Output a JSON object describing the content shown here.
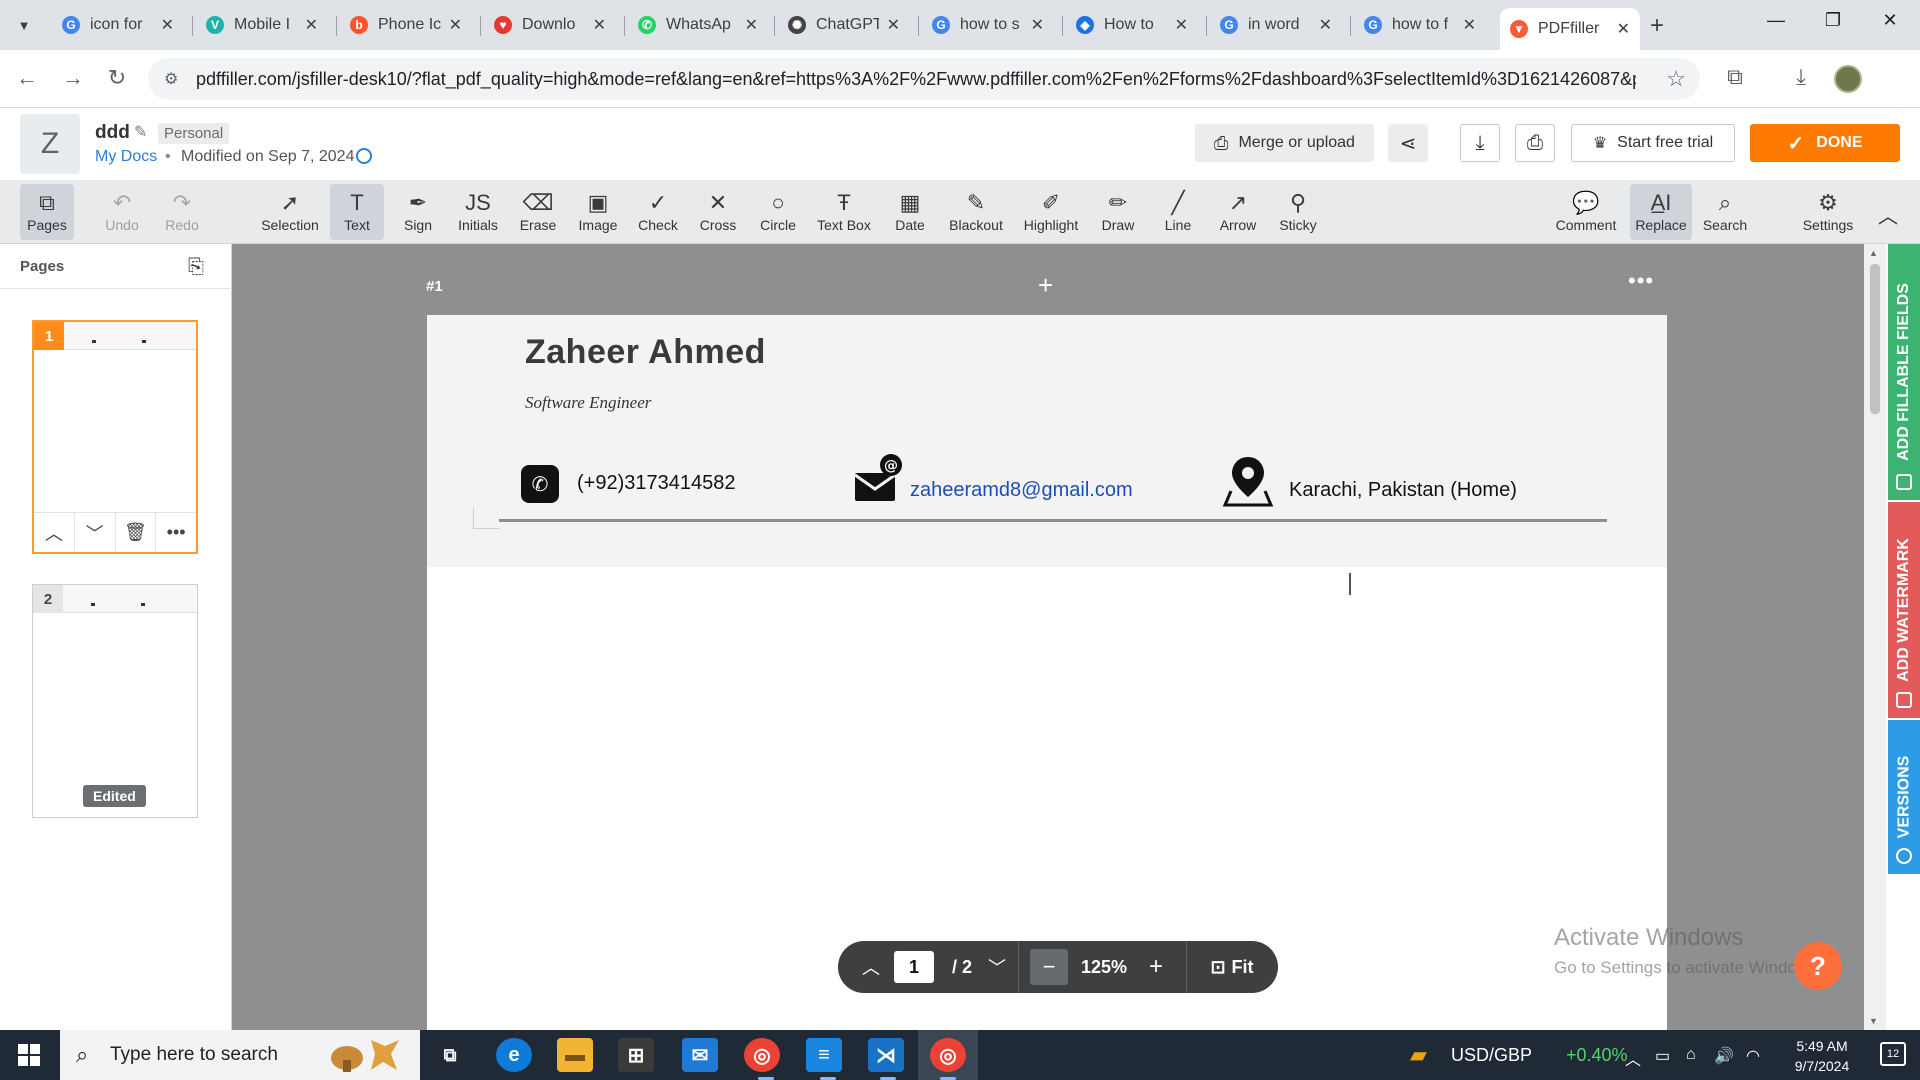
{
  "browser": {
    "tabs": [
      {
        "title": "icon for",
        "favicon": "google-icon",
        "color": "#4285f4"
      },
      {
        "title": "Mobile I",
        "favicon": "vector-icon",
        "color": "#20b2aa"
      },
      {
        "title": "Phone Ic",
        "favicon": "brave-icon",
        "color": "#fb542b"
      },
      {
        "title": "Downlo",
        "favicon": "heart-icon",
        "color": "#e53935"
      },
      {
        "title": "WhatsAp",
        "favicon": "whatsapp-icon",
        "color": "#25d366"
      },
      {
        "title": "ChatGPT",
        "favicon": "chatgpt-icon",
        "color": "#444444"
      },
      {
        "title": "how to s",
        "favicon": "google-icon",
        "color": "#4285f4"
      },
      {
        "title": "How to",
        "favicon": "tab-icon",
        "color": "#1a73e8"
      },
      {
        "title": "in word",
        "favicon": "google-icon",
        "color": "#4285f4"
      },
      {
        "title": "how to f",
        "favicon": "google-icon",
        "color": "#4285f4"
      },
      {
        "title": "PDFfiller",
        "favicon": "pdffiller-icon",
        "color": "#ff5a36",
        "active": true
      }
    ],
    "url": "pdffiller.com/jsfiller-desk10/?flat_pdf_quality=high&mode=ref&lang=en&ref=https%3A%2F%2Fwww.pdffiller.com%2Fen%2Fforms%2Fdashboard%3FselectItemId%3D1621426087&proje..."
  },
  "header": {
    "avatar_letter": "Z",
    "doc_name": "ddd",
    "account_badge": "Personal",
    "breadcrumb": "My Docs",
    "modified": "Modified on Sep 7, 2024",
    "merge_label": "Merge or upload",
    "trial_label": "Start free trial",
    "done_label": "DONE"
  },
  "toolbar": {
    "pages": "Pages",
    "undo": "Undo",
    "redo": "Redo",
    "selection": "Selection",
    "text": "Text",
    "sign": "Sign",
    "initials": "Initials",
    "erase": "Erase",
    "image": "Image",
    "check": "Check",
    "cross": "Cross",
    "circle": "Circle",
    "textbox": "Text Box",
    "date": "Date",
    "blackout": "Blackout",
    "highlight": "Highlight",
    "draw": "Draw",
    "line": "Line",
    "arrow": "Arrow",
    "sticky": "Sticky",
    "comment": "Comment",
    "replace": "Replace",
    "search": "Search",
    "settings": "Settings"
  },
  "pages_panel": {
    "title": "Pages",
    "thumb1_num": "1",
    "thumb2_num": "2",
    "edited_badge": "Edited"
  },
  "document": {
    "page_label": "#1",
    "name": "Zaheer Ahmed",
    "role": "Software Engineer",
    "phone": "(+92)3173414582",
    "email": "zaheeramd8@gmail.com",
    "location": "Karachi, Pakistan (Home)"
  },
  "zoom": {
    "current_page": "1",
    "total_pages": "/ 2",
    "zoom_level": "125%",
    "fit_label": "Fit"
  },
  "side_tabs": {
    "fillable": "ADD FILLABLE FIELDS",
    "watermark": "ADD WATERMARK",
    "versions": "VERSIONS"
  },
  "watermark": {
    "line1": "Activate Windows",
    "line2": "Go to Settings to activate Windows."
  },
  "taskbar": {
    "search_placeholder": "Type here to search",
    "stock_name": "USD/GBP",
    "stock_change": "+0.40%",
    "time": "5:49 AM",
    "date": "9/7/2024",
    "notifications": "12"
  },
  "colors": {
    "accent": "#ff7a00",
    "link": "#2b7fd6",
    "fillable_tab": "#3cb371",
    "watermark_tab": "#e35a5a",
    "versions_tab": "#2e9be6"
  }
}
